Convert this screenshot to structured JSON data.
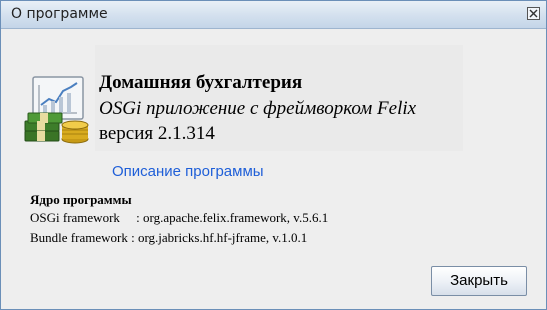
{
  "window": {
    "title": "О программе"
  },
  "about": {
    "app_name": "Домашняя бухгалтерия",
    "subtitle": "OSGi приложение с фреймворком Felix",
    "version": "версия 2.1.314",
    "link_text": "Описание программы"
  },
  "core": {
    "heading": "Ядро программы",
    "lines": [
      "OSGi framework     : org.apache.felix.framework, v.5.6.1",
      "Bundle framework : org.jabricks.hf.hf-jframe, v.1.0.1"
    ]
  },
  "buttons": {
    "close_label": "Закрыть"
  },
  "colors": {
    "link": "#1f5fd8",
    "titlebar": "#d3e0ee",
    "border": "#6b8fb8"
  },
  "icons": {
    "app": "money-chart-icon",
    "close": "close-icon"
  }
}
